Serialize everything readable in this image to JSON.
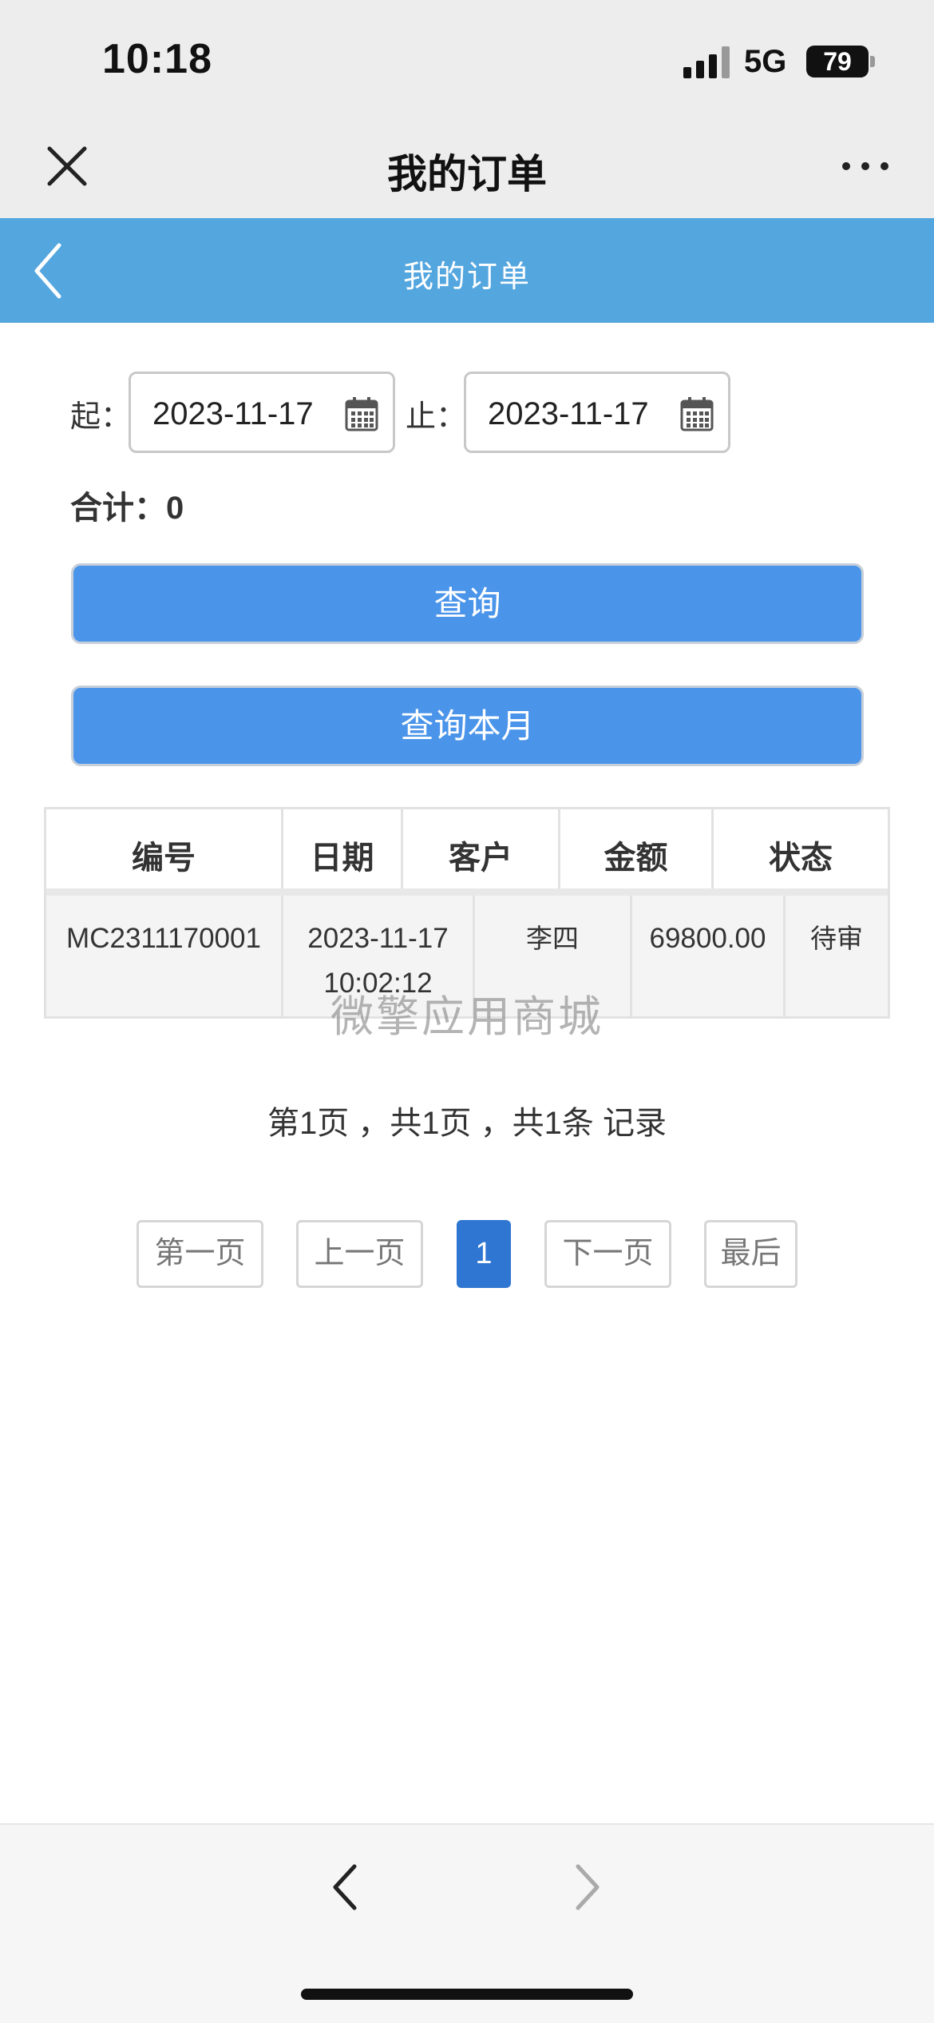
{
  "status_bar": {
    "time": "10:18",
    "network": "5G",
    "battery": "79"
  },
  "nav": {
    "title": "我的订单",
    "close_icon": "close-icon",
    "more_icon": "more-dots-icon"
  },
  "header": {
    "title": "我的订单",
    "back_icon": "chevron-left-icon"
  },
  "filter": {
    "start_label": "起：",
    "start_date": "2023-11-17",
    "end_label": "止：",
    "end_date": "2023-11-17",
    "calendar_icon": "calendar-icon"
  },
  "total_label": "合计：0",
  "buttons": {
    "query": "查询",
    "query_month": "查询本月"
  },
  "table": {
    "headers": [
      "编号",
      "日期",
      "客户",
      "金额",
      "状态"
    ],
    "rows": [
      {
        "id": "MC2311170001",
        "date": "2023-11-17",
        "time": "10:02:12",
        "customer": "李四",
        "amount": "69800.00",
        "status": "待审"
      }
    ]
  },
  "watermark": "微擎应用商城",
  "page_info": "第1页 ，共1页 ，共1条 记录",
  "pager": {
    "first": "第一页",
    "prev": "上一页",
    "current": "1",
    "next": "下一页",
    "last": "最后"
  },
  "bottom_bar": {
    "back_icon": "chevron-left-icon",
    "forward_icon": "chevron-right-icon"
  },
  "colors": {
    "header_blue": "#54a6df",
    "button_blue": "#4a94ea",
    "active_page": "#2f76d2"
  }
}
